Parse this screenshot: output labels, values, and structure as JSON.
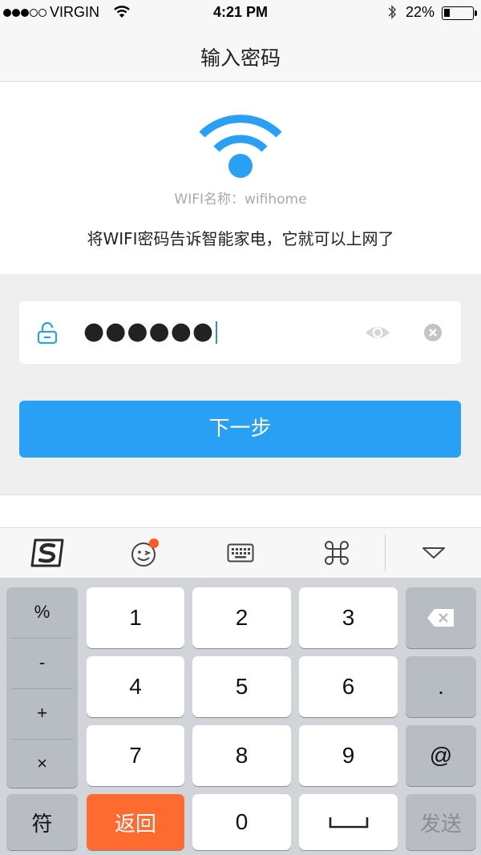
{
  "status_bar": {
    "carrier": "VIRGIN",
    "time": "4:21 PM",
    "battery": "22%",
    "battery_level": 0.22,
    "signal_bars": 3,
    "signal_total": 5
  },
  "nav": {
    "title": "输入密码"
  },
  "wifi": {
    "ssid_line": "WIFI名称：wifihome",
    "hint": "将WIFI密码告诉智能家电，它就可以上网了",
    "icon": "wifi-icon",
    "icon_color": "#2aa0f4"
  },
  "password": {
    "value": "●●●●●●",
    "icons": {
      "left": "lock-icon",
      "eye": "eye-icon",
      "clear": "clear-icon"
    }
  },
  "next_button": {
    "label": "下一步",
    "color": "#2aa0f4"
  },
  "keyboard_toolbar": {
    "items": [
      "sogou-logo-icon",
      "emoji-icon",
      "keyboard-icon",
      "command-icon",
      "collapse-icon"
    ],
    "badge_color": "#ff5a26"
  },
  "keyboard": {
    "symbols": [
      "%",
      "-",
      "+",
      "×"
    ],
    "digits": [
      "1",
      "2",
      "3",
      "4",
      "5",
      "6",
      "7",
      "8",
      "9"
    ],
    "dot": ".",
    "at": "@",
    "bottom": {
      "symbols": "符",
      "back": "返回",
      "zero": "0",
      "send": "发送"
    },
    "backspace_icon": "backspace-icon",
    "space_icon": "space-icon",
    "back_color": "#fe6b31"
  }
}
